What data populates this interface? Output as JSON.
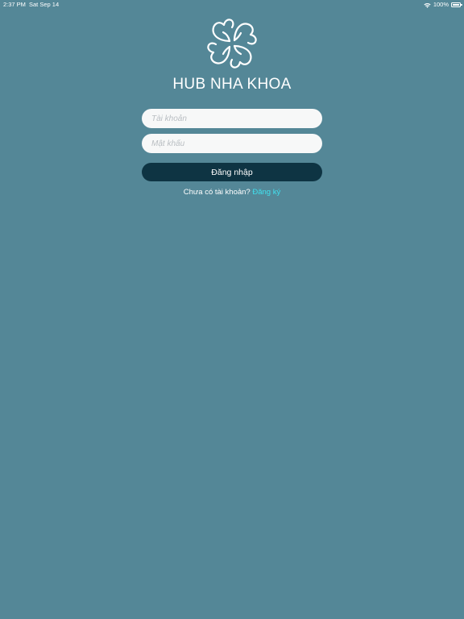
{
  "status_bar": {
    "time": "2:37 PM",
    "date": "Sat Sep 14",
    "battery": "100%",
    "icons": [
      "wifi-icon",
      "battery-icon"
    ]
  },
  "app": {
    "logo_icon": "tooth-clover-logo-icon",
    "title": "HUB NHA KHOA"
  },
  "form": {
    "username_placeholder": "Tài khoản",
    "password_placeholder": "Mật khẩu",
    "login_label": "Đăng nhập"
  },
  "register": {
    "prompt": "Chưa có tài khoản?",
    "link_label": "Đăng ký"
  },
  "colors": {
    "background": "#548797",
    "button": "#0e3443",
    "link": "#41e0ee",
    "input_bg": "#f7f8f8"
  }
}
